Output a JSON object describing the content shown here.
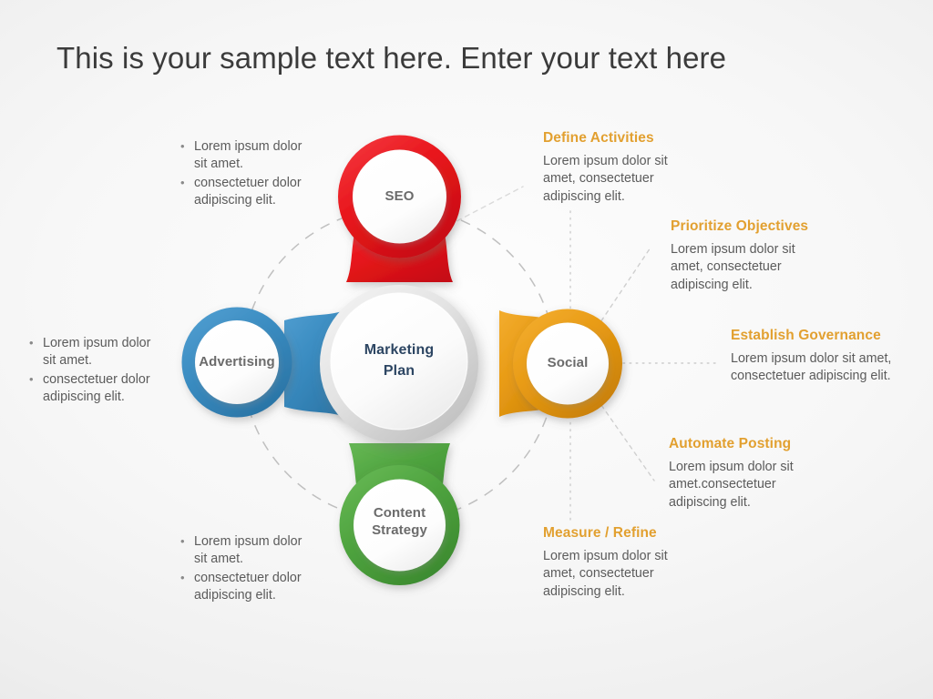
{
  "slide": {
    "title": "This is your sample text here. Enter your text here",
    "background_color": "#f2f2f2"
  },
  "hub": {
    "label_line1": "Marketing",
    "label_line2": "Plan",
    "text_color": "#2d4663"
  },
  "nodes": [
    {
      "id": "seo",
      "label": "SEO",
      "color": "#e8151b",
      "position": "top"
    },
    {
      "id": "social",
      "label": "Social",
      "color": "#e89b15",
      "position": "right"
    },
    {
      "id": "content",
      "label_line1": "Content",
      "label_line2": "Strategy",
      "label": "Content Strategy",
      "color": "#4fa43f",
      "position": "bottom"
    },
    {
      "id": "advertising",
      "label": "Advertising",
      "color": "#3a8cc1",
      "position": "left"
    }
  ],
  "bullet_lists": [
    {
      "id": "top-left",
      "items": [
        "Lorem ipsum dolor sit amet.",
        "consectetuer dolor adipiscing elit."
      ]
    },
    {
      "id": "middle-left",
      "items": [
        "Lorem ipsum dolor sit amet.",
        "consectetuer dolor adipiscing elit."
      ]
    },
    {
      "id": "bottom-left",
      "items": [
        "Lorem ipsum dolor sit amet.",
        "consectetuer dolor adipiscing elit."
      ]
    }
  ],
  "callouts": [
    {
      "id": "define-activities",
      "heading": "Define Activities",
      "body": "Lorem ipsum dolor sit amet, consectetuer adipiscing elit.",
      "heading_color": "#e2a030"
    },
    {
      "id": "prioritize-objectives",
      "heading": "Prioritize Objectives",
      "body": "Lorem ipsum dolor sit amet, consectetuer adipiscing elit.",
      "heading_color": "#e2a030"
    },
    {
      "id": "establish-governance",
      "heading": "Establish Governance",
      "body": "Lorem ipsum dolor sit amet, consectetuer adipiscing elit.",
      "heading_color": "#e2a030"
    },
    {
      "id": "automate-posting",
      "heading": "Automate Posting",
      "body": "Lorem ipsum dolor sit amet.consectetuer adipiscing elit.",
      "heading_color": "#e2a030"
    },
    {
      "id": "measure-refine",
      "heading": "Measure / Refine",
      "body": "Lorem ipsum dolor sit amet, consectetuer adipiscing elit.",
      "heading_color": "#e2a030"
    }
  ],
  "decor": {
    "dashed_circle_color": "#b8b8b8",
    "connector_color": "#c2c2c2"
  }
}
